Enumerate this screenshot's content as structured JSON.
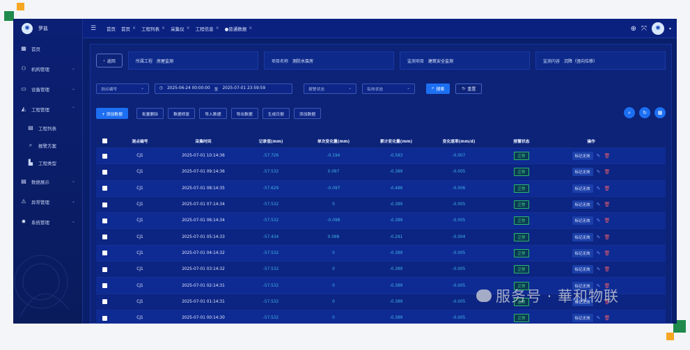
{
  "sidebar": {
    "logo_text": "罗盐",
    "items": [
      {
        "label": "首页",
        "icon": "home-icon",
        "glyph": "▦"
      },
      {
        "label": "机构管理",
        "icon": "org-icon",
        "glyph": "⚇",
        "chevron": "⌄"
      },
      {
        "label": "设备管理",
        "icon": "device-icon",
        "glyph": "▭",
        "chevron": "⌄"
      },
      {
        "label": "工程管理",
        "icon": "project-icon",
        "glyph": "◭",
        "chevron": "⌃"
      }
    ],
    "sub_items": [
      {
        "label": "工程列表",
        "icon": "list-icon",
        "glyph": "▤"
      },
      {
        "label": "报警方案",
        "icon": "alarm-icon",
        "glyph": "⌕"
      },
      {
        "label": "工程类型",
        "icon": "type-icon",
        "glyph": "▙"
      }
    ],
    "items2": [
      {
        "label": "数据展示",
        "icon": "data-icon",
        "glyph": "▤",
        "chevron": "⌄"
      },
      {
        "label": "异常管理",
        "icon": "warning-icon",
        "glyph": "⚠",
        "chevron": "⌄"
      },
      {
        "label": "系统管理",
        "icon": "settings-icon",
        "glyph": "✹",
        "chevron": "⌄"
      }
    ]
  },
  "topbar": {
    "tabs": [
      {
        "label": "首页",
        "closable": false
      },
      {
        "label": "首页",
        "closable": true
      },
      {
        "label": "工程列表",
        "closable": true
      },
      {
        "label": "采集仪",
        "closable": true
      },
      {
        "label": "工程信息",
        "closable": true
      },
      {
        "label": "●普通数据",
        "closable": true
      }
    ],
    "close_glyph": "×"
  },
  "info": {
    "back": "返回",
    "project_label": "所属工程",
    "project_value": "房屋监测",
    "item_label": "项目名称",
    "item_value": "测防水泵房",
    "monitor_label": "监测项目",
    "monitor_value": "建筑安全监测",
    "content_label": "监测内容",
    "content_value": "沉降（竖向位移）"
  },
  "filters": {
    "point_placeholder": "测点编号",
    "date_start": "2025-06-24 00:00:00",
    "date_sep": "至",
    "date_end": "2025-07-01 23:59:59",
    "alarm_placeholder": "报警状态",
    "valid_placeholder": "有效状态",
    "search": "搜索",
    "reset": "重置"
  },
  "actions": {
    "add": "+ 添加数据",
    "batch_delete": "批量删除",
    "repair": "数据修复",
    "import": "导入数据",
    "export": "导出数据",
    "daily": "生成日报",
    "add_data": "添加数据"
  },
  "table": {
    "headers": [
      "",
      "测点编号",
      "采集时间",
      "记录值(mm)",
      "单次变化量(mm)",
      "累计变化量(mm)",
      "变化速率(mm/d)",
      "报警状态",
      "操作"
    ],
    "rows": [
      {
        "point": "CJ1",
        "time": "2025-07-01 10:14:36",
        "value": "-57.726",
        "single": "-0.194",
        "total": "-0.583",
        "rate": "-0.007",
        "status": "正常"
      },
      {
        "point": "CJ1",
        "time": "2025-07-01 09:14:36",
        "value": "-57.532",
        "single": "0.097",
        "total": "-0.389",
        "rate": "-0.005",
        "status": "正常"
      },
      {
        "point": "CJ1",
        "time": "2025-07-01 08:14:35",
        "value": "-57.629",
        "single": "-0.097",
        "total": "-0.486",
        "rate": "-0.006",
        "status": "正常"
      },
      {
        "point": "CJ1",
        "time": "2025-07-01 07:14:34",
        "value": "-57.532",
        "single": "0",
        "total": "-0.389",
        "rate": "-0.005",
        "status": "正常"
      },
      {
        "point": "CJ1",
        "time": "2025-07-01 06:14:34",
        "value": "-57.532",
        "single": "-0.098",
        "total": "-0.389",
        "rate": "-0.005",
        "status": "正常"
      },
      {
        "point": "CJ1",
        "time": "2025-07-01 05:14:33",
        "value": "-57.434",
        "single": "0.098",
        "total": "-0.291",
        "rate": "-0.004",
        "status": "正常"
      },
      {
        "point": "CJ1",
        "time": "2025-07-01 04:14:32",
        "value": "-57.532",
        "single": "0",
        "total": "-0.389",
        "rate": "-0.005",
        "status": "正常"
      },
      {
        "point": "CJ1",
        "time": "2025-07-01 03:14:32",
        "value": "-57.532",
        "single": "0",
        "total": "-0.389",
        "rate": "-0.005",
        "status": "正常"
      },
      {
        "point": "CJ1",
        "time": "2025-07-01 02:14:31",
        "value": "-57.532",
        "single": "0",
        "total": "-0.389",
        "rate": "-0.005",
        "status": "正常"
      },
      {
        "point": "CJ1",
        "time": "2025-07-01 01:14:31",
        "value": "-57.532",
        "single": "0",
        "total": "-0.389",
        "rate": "-0.005",
        "status": "正常"
      },
      {
        "point": "CJ1",
        "time": "2025-07-01 00:14:30",
        "value": "-57.532",
        "single": "0",
        "total": "-0.389",
        "rate": "-0.005",
        "status": "正常"
      }
    ],
    "mark_label": "标记无效"
  },
  "watermark": "服务号 · 華和物联",
  "colors": {
    "accent": "#1d6ff2",
    "background": "#0a1f6b",
    "number": "#41b8e8",
    "ok": "#43d17c",
    "danger": "#e05c6c"
  }
}
